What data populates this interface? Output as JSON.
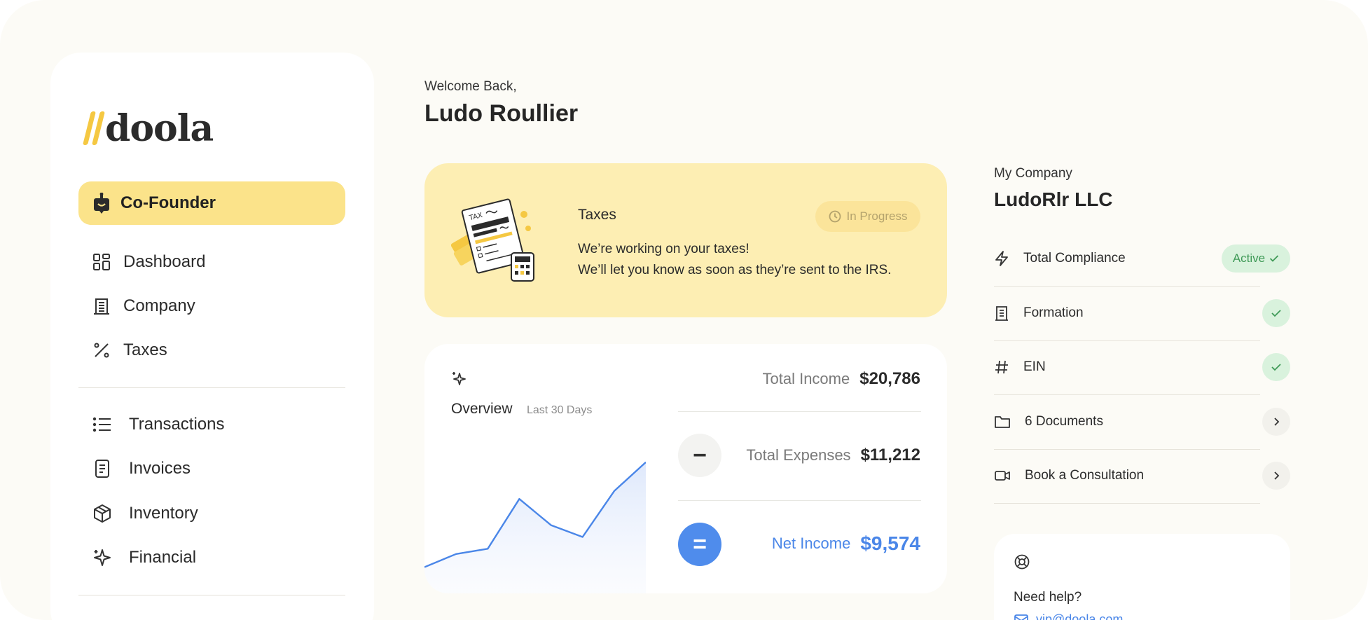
{
  "brand": {
    "name": "doola",
    "accent": "#f5c842"
  },
  "sidebar": {
    "cofounder_label": "Co-Founder",
    "items": [
      {
        "label": "Dashboard",
        "icon": "grid-icon"
      },
      {
        "label": "Company",
        "icon": "building-icon"
      },
      {
        "label": "Taxes",
        "icon": "percent-icon"
      },
      {
        "label": "Transactions",
        "icon": "list-icon"
      },
      {
        "label": "Invoices",
        "icon": "document-icon"
      },
      {
        "label": "Inventory",
        "icon": "box-icon"
      },
      {
        "label": "Financial",
        "icon": "sparkle-icon"
      }
    ]
  },
  "header": {
    "welcome": "Welcome Back,",
    "username": "Ludo Roullier"
  },
  "taxes_card": {
    "title": "Taxes",
    "status": "In Progress",
    "line1": "We’re working on your taxes!",
    "line2": "We’ll let you know as soon as they’re sent to the IRS."
  },
  "overview": {
    "title": "Overview",
    "period": "Last 30 Days",
    "total_income_label": "Total Income",
    "total_income_value": "$20,786",
    "total_expenses_label": "Total Expenses",
    "total_expenses_value": "$11,212",
    "net_income_label": "Net Income",
    "net_income_value": "$9,574",
    "minus_symbol": "−",
    "equals_symbol": "=",
    "accent": "#4a86e8"
  },
  "chart_data": {
    "type": "area",
    "title": "",
    "xlabel": "",
    "ylabel": "",
    "values": [
      2,
      3,
      3.4,
      7.2,
      5.2,
      4.3,
      7.8,
      10
    ]
  },
  "company": {
    "heading": "My Company",
    "name": "LudoRlr LLC",
    "rows": [
      {
        "label": "Total Compliance",
        "icon": "bolt-icon",
        "badge": "Active"
      },
      {
        "label": "Formation",
        "icon": "building-icon"
      },
      {
        "label": "EIN",
        "icon": "hash-icon"
      },
      {
        "label": "6 Documents",
        "icon": "folder-icon"
      },
      {
        "label": "Book a Consultation",
        "icon": "video-icon"
      }
    ]
  },
  "help": {
    "title": "Need help?",
    "email": "vip@doola.com"
  }
}
